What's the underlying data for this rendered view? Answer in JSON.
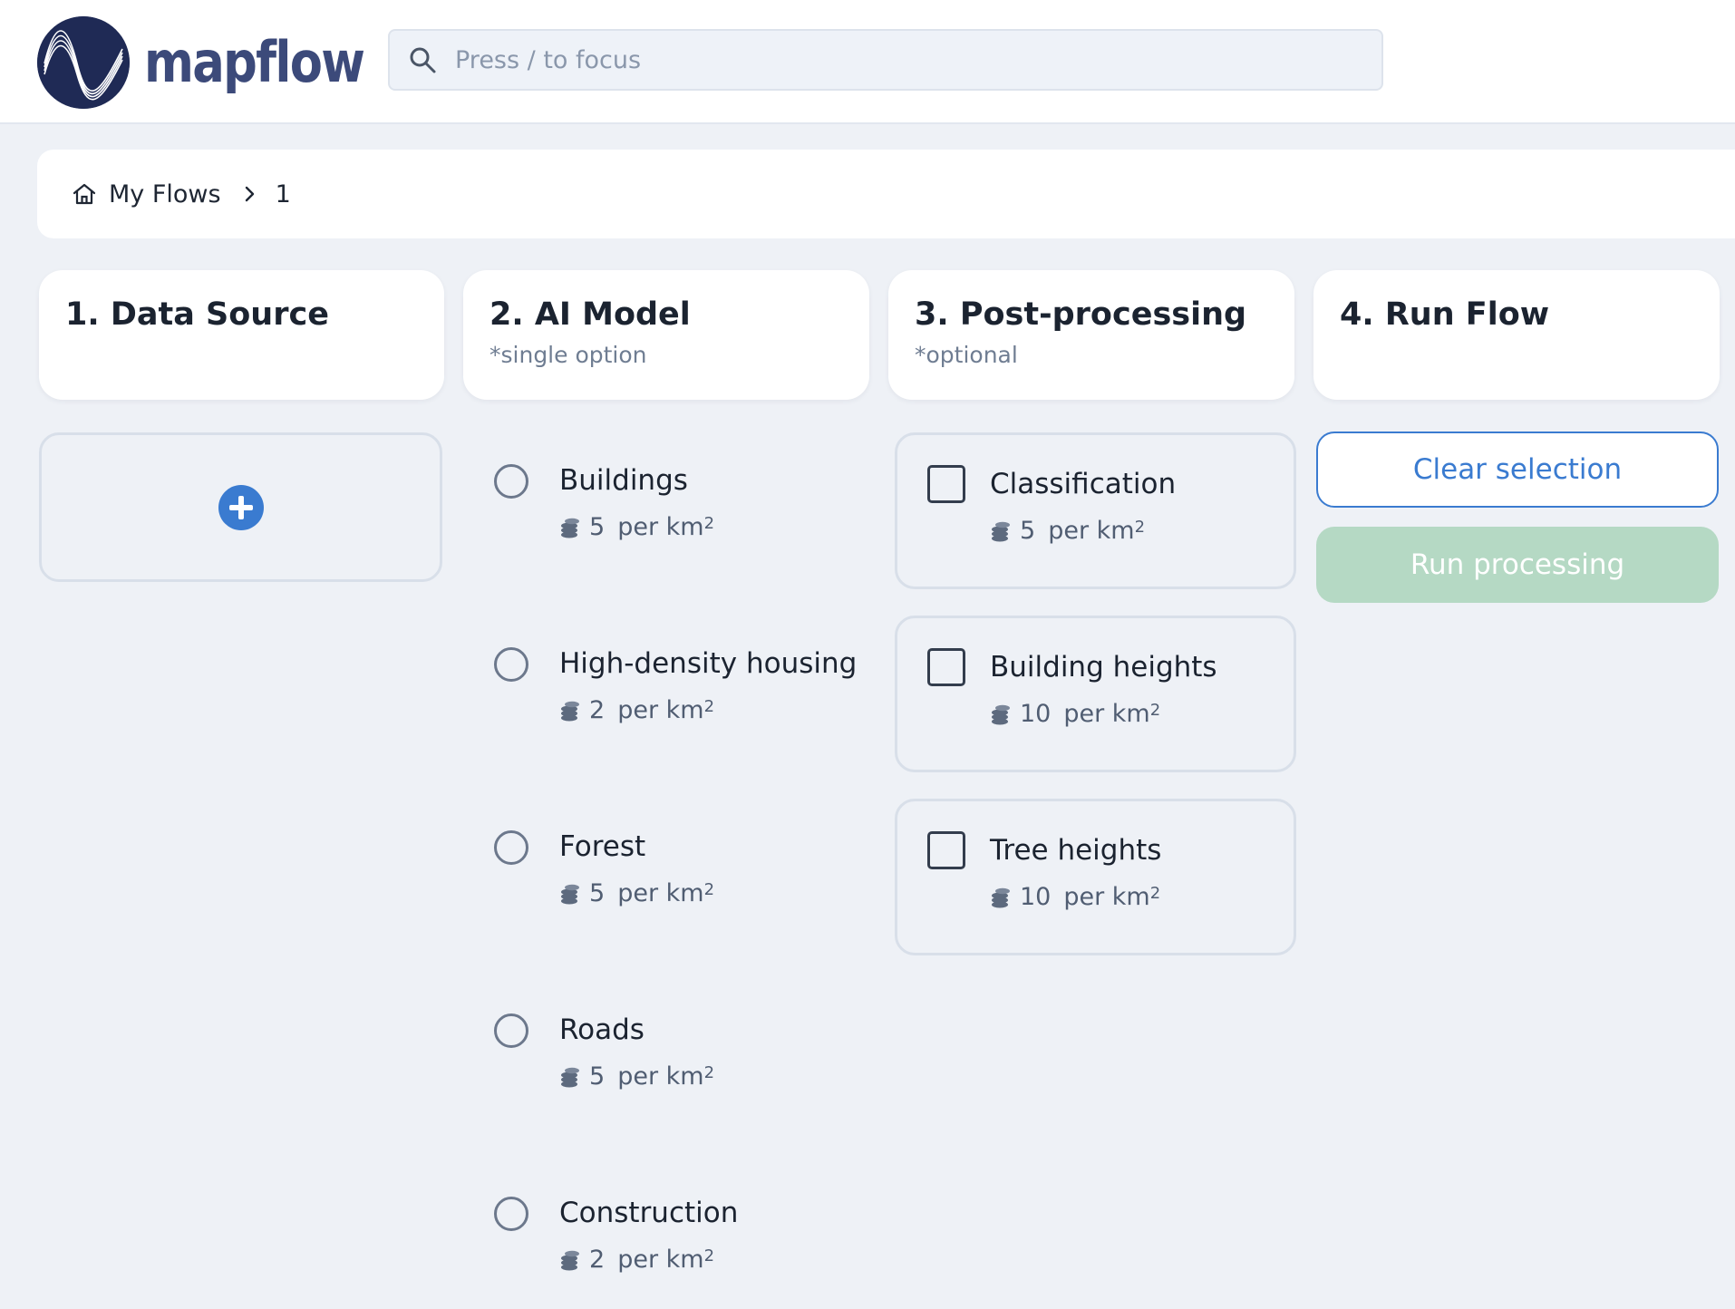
{
  "header": {
    "logo_text": "mapflow",
    "search_placeholder": "Press / to focus"
  },
  "breadcrumb": {
    "home_label": "My Flows",
    "current": "1"
  },
  "columns": [
    {
      "title": "1. Data Source",
      "subtitle": ""
    },
    {
      "title": "2. AI Model",
      "subtitle": "*single option"
    },
    {
      "title": "3. Post-processing",
      "subtitle": "*optional"
    },
    {
      "title": "4. Run Flow",
      "subtitle": ""
    }
  ],
  "models": [
    {
      "name": "Buildings",
      "price": "5",
      "unit": "per km",
      "unit_sup": "2",
      "selected": false
    },
    {
      "name": "High-density housing",
      "price": "2",
      "unit": "per km",
      "unit_sup": "2",
      "selected": false
    },
    {
      "name": "Forest",
      "price": "5",
      "unit": "per km",
      "unit_sup": "2",
      "selected": false
    },
    {
      "name": "Roads",
      "price": "5",
      "unit": "per km",
      "unit_sup": "2",
      "selected": false
    },
    {
      "name": "Construction",
      "price": "2",
      "unit": "per km",
      "unit_sup": "2",
      "selected": false
    }
  ],
  "postprocessing": [
    {
      "name": "Classification",
      "price": "5",
      "unit": "per km",
      "unit_sup": "2",
      "checked": false
    },
    {
      "name": "Building heights",
      "price": "10",
      "unit": "per km",
      "unit_sup": "2",
      "checked": false
    },
    {
      "name": "Tree heights",
      "price": "10",
      "unit": "per km",
      "unit_sup": "2",
      "checked": false
    }
  ],
  "actions": {
    "clear_label": "Clear selection",
    "run_label": "Run processing",
    "run_enabled": false
  },
  "colors": {
    "accent": "#3a7bd0",
    "logo_bg": "#1f2a55",
    "run_disabled": "#b5d9c4",
    "page_bg": "#eef1f6"
  }
}
